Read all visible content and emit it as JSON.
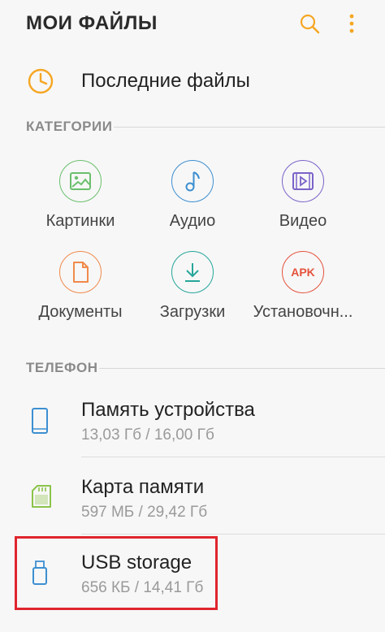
{
  "header": {
    "title": "МОИ ФАЙЛЫ",
    "search_icon": "search-icon",
    "menu_icon": "more-vert-icon"
  },
  "recent": {
    "label": "Последние файлы",
    "icon": "clock-icon"
  },
  "categories_section": {
    "title": "КАТЕГОРИИ"
  },
  "categories": [
    {
      "label": "Картинки",
      "icon": "image-icon",
      "color": "#6bbf6e"
    },
    {
      "label": "Аудио",
      "icon": "music-note-icon",
      "color": "#3d8fd1"
    },
    {
      "label": "Видео",
      "icon": "video-icon",
      "color": "#7b62c9"
    },
    {
      "label": "Документы",
      "icon": "document-icon",
      "color": "#f08a4b"
    },
    {
      "label": "Загрузки",
      "icon": "download-icon",
      "color": "#26a69a"
    },
    {
      "label": "Установочн...",
      "icon": "apk-icon",
      "color": "#e5533d",
      "icon_text": "APK"
    }
  ],
  "phone_section": {
    "title": "ТЕЛЕФОН"
  },
  "storages": [
    {
      "name": "Память устройства",
      "size": "13,03 Гб / 16,00 Гб",
      "icon": "phone-icon",
      "color": "#3d8fd1"
    },
    {
      "name": "Карта памяти",
      "size": "597 МБ / 29,42 Гб",
      "icon": "sd-card-icon",
      "color": "#8bc34a"
    },
    {
      "name": "USB storage",
      "size": "656 КБ / 14,41 Гб",
      "icon": "usb-icon",
      "color": "#3d8fd1"
    }
  ],
  "colors": {
    "accent": "#f5a623",
    "highlight": "#e0252e"
  }
}
